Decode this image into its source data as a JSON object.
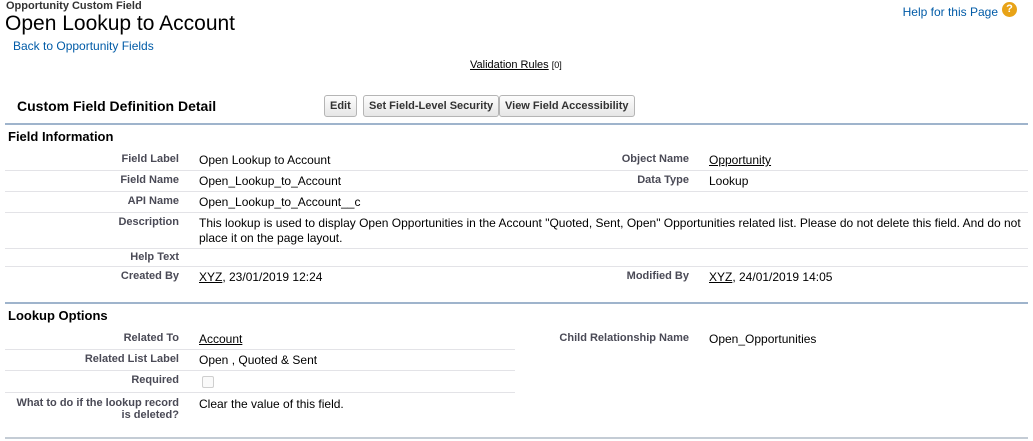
{
  "header": {
    "object_type": "Opportunity Custom Field",
    "title": "Open Lookup to Account",
    "back_link": "Back to Opportunity Fields",
    "help_link": "Help for this Page",
    "help_icon": "?"
  },
  "validation_rules": {
    "label": "Validation Rules",
    "count": "[0]"
  },
  "detail": {
    "title": "Custom Field Definition Detail",
    "buttons": [
      "Edit",
      "Set Field-Level Security",
      "View Field Accessibility"
    ]
  },
  "field_information": {
    "title": "Field Information",
    "field_label": {
      "label": "Field Label",
      "value": "Open Lookup to Account"
    },
    "object_name": {
      "label": "Object Name",
      "value": "Opportunity"
    },
    "field_name": {
      "label": "Field Name",
      "value": "Open_Lookup_to_Account"
    },
    "data_type": {
      "label": "Data Type",
      "value": "Lookup"
    },
    "api_name": {
      "label": "API Name",
      "value": "Open_Lookup_to_Account__c"
    },
    "description": {
      "label": "Description",
      "line1": "This lookup is used to display Open Opportunities in the Account \"Quoted, Sent, Open\" Opportunities related list. Please do not delete this field. And do not",
      "line2": "place it on the page layout."
    },
    "help_text": {
      "label": "Help Text",
      "value": ""
    },
    "created_by": {
      "label": "Created By",
      "user": "XYZ",
      "date": ", 23/01/2019 12:24"
    },
    "modified_by": {
      "label": "Modified By",
      "user": "XYZ",
      "date": ", 24/01/2019 14:05"
    }
  },
  "lookup_options": {
    "title": "Lookup Options",
    "related_to": {
      "label": "Related To",
      "value": "Account"
    },
    "child_relationship": {
      "label": "Child Relationship Name",
      "value": "Open_Opportunities"
    },
    "related_list_label": {
      "label": "Related List Label",
      "value": "Open , Quoted & Sent"
    },
    "required": {
      "label": "Required",
      "checked": false
    },
    "delete_action": {
      "label_line1": "What to do if the lookup record",
      "label_line2": "is deleted?",
      "value": "Clear the value of this field."
    }
  },
  "colors": {
    "link": "#015ba7",
    "section_border": "#9fb4cc",
    "help_icon": "#e8a317",
    "label_text": "#4a4a56"
  }
}
